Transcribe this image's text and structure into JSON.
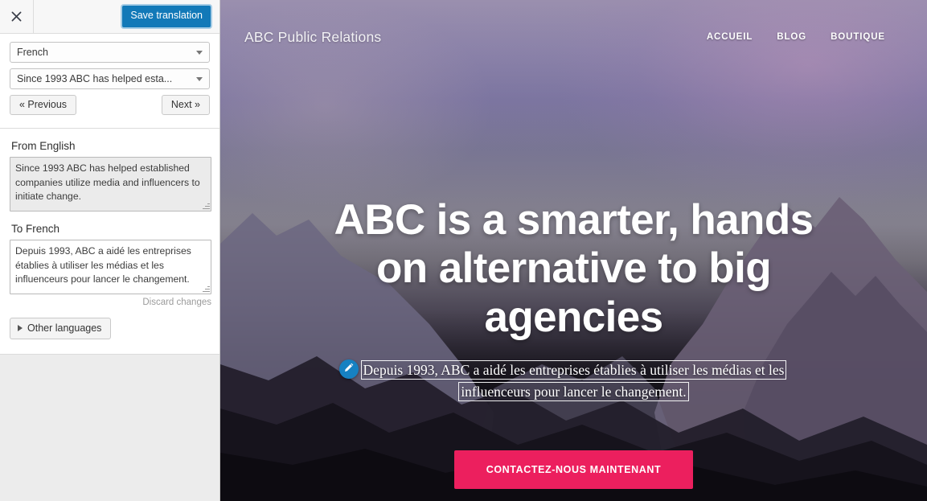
{
  "sidebar": {
    "close_icon": "close-icon",
    "save_label": "Save translation",
    "language_select": {
      "value": "French",
      "options": [
        "French"
      ]
    },
    "string_select": {
      "value": "Since 1993 ABC has helped esta...",
      "options": [
        "Since 1993 ABC has helped esta..."
      ]
    },
    "prev_label": "« Previous",
    "next_label": "Next »",
    "source": {
      "label": "From English",
      "value": "Since 1993 ABC has helped established companies utilize media and influencers to initiate change."
    },
    "target": {
      "label": "To French",
      "value": "Depuis 1993, ABC a aidé les entreprises établies à utiliser les médias et les influenceurs pour lancer le changement."
    },
    "discard_label": "Discard changes",
    "other_languages_label": "Other languages"
  },
  "site": {
    "brand": "ABC Public Relations",
    "nav": [
      {
        "label": "ACCUEIL"
      },
      {
        "label": "BLOG"
      },
      {
        "label": "BOUTIQUE"
      }
    ],
    "hero": {
      "title": "ABC is a smarter, hands on alternative to big agencies",
      "subtitle": "Depuis 1993, ABC a aidé les entreprises établies à utiliser les médias et les influenceurs pour lancer le changement.",
      "edit_icon": "pencil-icon",
      "cta_label": "CONTACTEZ-NOUS MAINTENANT"
    }
  },
  "colors": {
    "save_button": "#1279b8",
    "cta_pink": "#ec1f5e",
    "edit_badge_blue": "#1681c2",
    "sidebar_bg": "#ececec",
    "panel_bg": "#ffffff"
  }
}
